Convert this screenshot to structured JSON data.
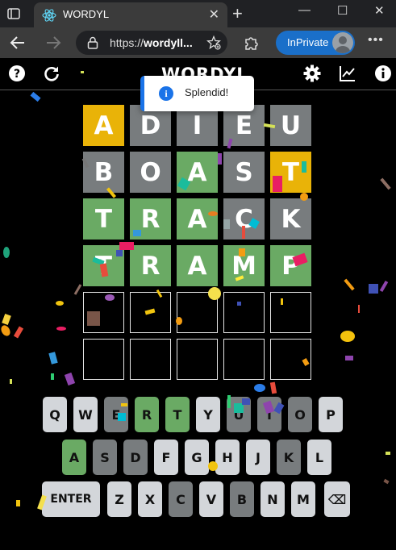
{
  "browser": {
    "tab_title": "WORDYL",
    "tab_close": "✕",
    "new_tab": "+",
    "url_prefix": "https://",
    "url_host": "wordyll...",
    "inprivate_label": "InPrivate",
    "more": "•••",
    "window_minimize": "—",
    "window_maximize": "☐",
    "window_close": "✕"
  },
  "game": {
    "title": "WORDYL",
    "toast": "Splendid!",
    "toast_icon": "i"
  },
  "colors": {
    "correct": "#6aaa64",
    "present": "#e9b308",
    "absent": "#787c7e",
    "key_default": "#d3d6da",
    "toast_accent": "#1a73e8"
  },
  "grid": [
    [
      {
        "letter": "A",
        "state": "present"
      },
      {
        "letter": "D",
        "state": "absent"
      },
      {
        "letter": "I",
        "state": "absent"
      },
      {
        "letter": "E",
        "state": "absent"
      },
      {
        "letter": "U",
        "state": "absent"
      }
    ],
    [
      {
        "letter": "B",
        "state": "absent"
      },
      {
        "letter": "O",
        "state": "absent"
      },
      {
        "letter": "A",
        "state": "correct"
      },
      {
        "letter": "S",
        "state": "absent"
      },
      {
        "letter": "T",
        "state": "present"
      }
    ],
    [
      {
        "letter": "T",
        "state": "correct"
      },
      {
        "letter": "R",
        "state": "correct"
      },
      {
        "letter": "A",
        "state": "correct"
      },
      {
        "letter": "C",
        "state": "absent"
      },
      {
        "letter": "K",
        "state": "absent"
      }
    ],
    [
      {
        "letter": "T",
        "state": "correct"
      },
      {
        "letter": "R",
        "state": "correct"
      },
      {
        "letter": "A",
        "state": "correct"
      },
      {
        "letter": "M",
        "state": "correct"
      },
      {
        "letter": "P",
        "state": "correct"
      }
    ],
    [
      {
        "letter": "",
        "state": "empty"
      },
      {
        "letter": "",
        "state": "empty"
      },
      {
        "letter": "",
        "state": "empty"
      },
      {
        "letter": "",
        "state": "empty"
      },
      {
        "letter": "",
        "state": "empty"
      }
    ],
    [
      {
        "letter": "",
        "state": "empty"
      },
      {
        "letter": "",
        "state": "empty"
      },
      {
        "letter": "",
        "state": "empty"
      },
      {
        "letter": "",
        "state": "empty"
      },
      {
        "letter": "",
        "state": "empty"
      }
    ]
  ],
  "keyboard": [
    [
      {
        "label": "Q",
        "state": "default"
      },
      {
        "label": "W",
        "state": "default"
      },
      {
        "label": "E",
        "state": "absent"
      },
      {
        "label": "R",
        "state": "correct"
      },
      {
        "label": "T",
        "state": "correct"
      },
      {
        "label": "Y",
        "state": "default"
      },
      {
        "label": "U",
        "state": "absent"
      },
      {
        "label": "I",
        "state": "absent"
      },
      {
        "label": "O",
        "state": "absent"
      },
      {
        "label": "P",
        "state": "default"
      }
    ],
    [
      {
        "label": "A",
        "state": "correct"
      },
      {
        "label": "S",
        "state": "absent"
      },
      {
        "label": "D",
        "state": "absent"
      },
      {
        "label": "F",
        "state": "default"
      },
      {
        "label": "G",
        "state": "default"
      },
      {
        "label": "H",
        "state": "default"
      },
      {
        "label": "J",
        "state": "default"
      },
      {
        "label": "K",
        "state": "absent"
      },
      {
        "label": "L",
        "state": "default"
      }
    ],
    [
      {
        "label": "ENTER",
        "state": "default"
      },
      {
        "label": "Z",
        "state": "default"
      },
      {
        "label": "X",
        "state": "default"
      },
      {
        "label": "C",
        "state": "absent"
      },
      {
        "label": "V",
        "state": "default"
      },
      {
        "label": "B",
        "state": "absent"
      },
      {
        "label": "N",
        "state": "default"
      },
      {
        "label": "M",
        "state": "default"
      },
      {
        "label": "⌫",
        "state": "default"
      }
    ]
  ]
}
